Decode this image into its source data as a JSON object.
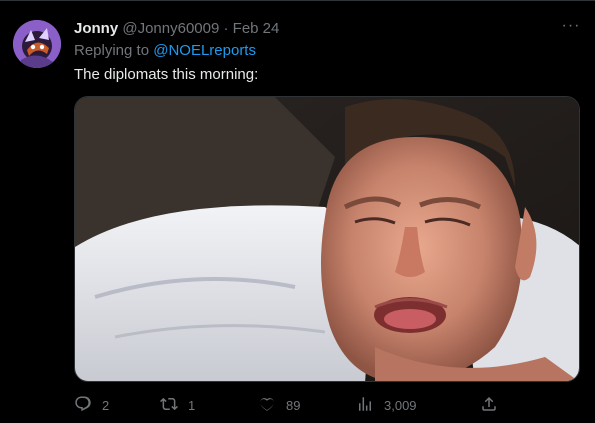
{
  "tweet": {
    "author": {
      "name": "Jonny",
      "handle": "@Jonny60009",
      "separator": "·",
      "date": "Feb 24"
    },
    "replying": {
      "prefix": "Replying to ",
      "mention": "@NOELreports"
    },
    "text": "The diplomats this morning:",
    "more": "···",
    "actions": {
      "reply_count": "2",
      "retweet_count": "1",
      "like_count": "89",
      "view_count": "3,009"
    }
  },
  "colors": {
    "background": "#000000",
    "text": "#e7e9ea",
    "muted": "#71767b",
    "link": "#1d9bf0",
    "avatar_bg": "#8a5fc8"
  },
  "icons": {
    "reply": "speech-bubble-icon",
    "retweet": "retweet-arrows-icon",
    "like": "heart-outline-icon",
    "views": "bar-chart-icon",
    "share": "share-upload-icon"
  }
}
